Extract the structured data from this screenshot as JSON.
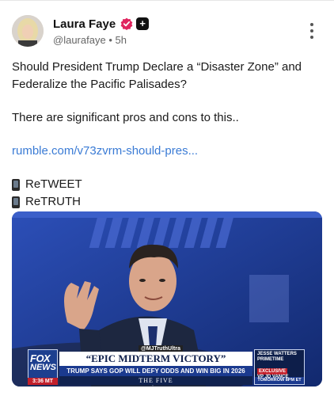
{
  "post": {
    "author_name": "Laura Faye",
    "handle": "@laurafaye",
    "separator": "•",
    "time": "5h",
    "plus_badge": "+",
    "colors": {
      "verified": "#e0245e",
      "link": "#3a7bd5",
      "badge": "#111111"
    }
  },
  "body": {
    "line1": "Should President Trump Declare a “Disaster Zone” and Federalize the Pacific Palisades?",
    "line2": "There are significant pros and cons to this..",
    "link": "rumble.com/v73zvrm-should-pres...",
    "share1": "ReTWEET",
    "share2": "ReTRUTH"
  },
  "media": {
    "handle_tag": "@MJTruthUltra",
    "headline": "“EPIC MIDTERM VICTORY”",
    "subheadline": "TRUMP SAYS GOP WILL DEFY ODDS AND WIN BIG IN 2026",
    "show_name": "THE FIVE",
    "network_line1": "FOX",
    "network_line2": "NEWS",
    "clock": "3:36 MT",
    "promo_line1": "JESSE WATTERS PRIMETIME",
    "promo_line2": "EXCLUSIVE",
    "promo_line3": "VP JD VANCE",
    "promo_line4": "TOMORROW 8PM ET"
  }
}
